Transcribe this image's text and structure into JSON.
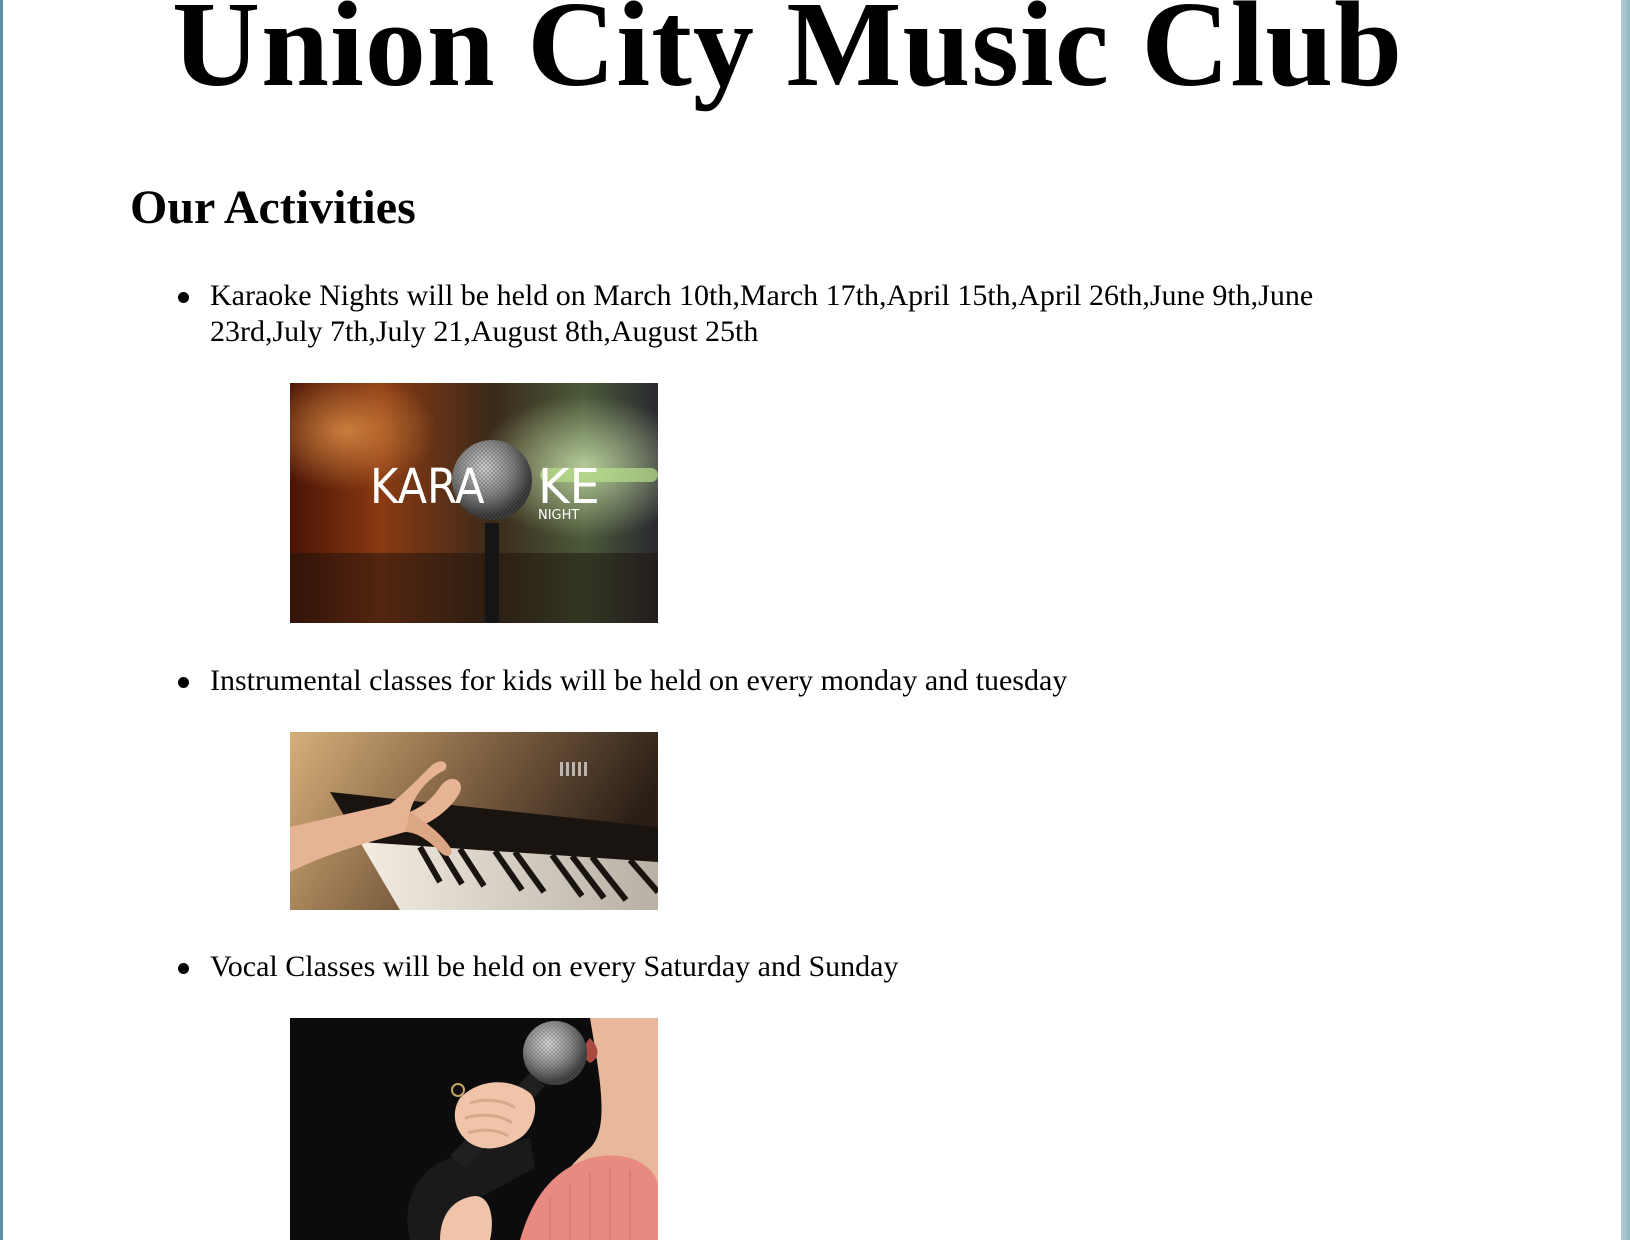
{
  "page": {
    "title": "Union City Music Club"
  },
  "activities_section": {
    "heading": "Our Activities",
    "items": [
      {
        "text": "Karaoke Nights will be held on March 10th,March 17th,April 15th,April 26th,June 9th,June 23rd,July 7th,July 21,August 8th,August 25th",
        "image": {
          "subject": "karaoke night microphone",
          "overlay_text_main": "KARA",
          "overlay_text_end": "KE",
          "overlay_text_sub": "NIGHT"
        }
      },
      {
        "text": "Instrumental classes for kids will be held on every monday and tuesday",
        "image": {
          "subject": "child's hand playing piano keys"
        }
      },
      {
        "text": "Vocal Classes will be held on every Saturday and Sunday",
        "image": {
          "subject": "woman singing into a microphone"
        }
      }
    ]
  }
}
